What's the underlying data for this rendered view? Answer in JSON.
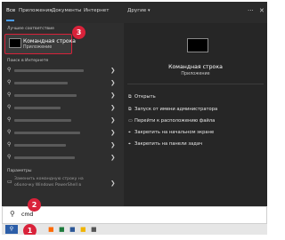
{
  "tabs": {
    "all": "Все",
    "apps": "Приложения",
    "documents": "Документы",
    "web": "Интернет",
    "more": "Другие"
  },
  "best_match": {
    "header": "Лучшее соответствие",
    "title": "Командная строка",
    "subtitle": "Приложение"
  },
  "web_section": {
    "header": "Поиск в Интернете"
  },
  "settings_section": {
    "header": "Параметры",
    "item1": "Заменить командную строку на",
    "item2": "оболочку Windows PowerShell в"
  },
  "details": {
    "title": "Командная строка",
    "subtitle": "Приложение",
    "actions": [
      "Открыть",
      "Запуск от имени администратора",
      "Перейти к расположению файла",
      "Закрепить на начальном экране",
      "Закрепить на панели задач"
    ]
  },
  "search": {
    "value": "cmd"
  },
  "steps": [
    "1",
    "2",
    "3"
  ],
  "colors": {
    "accent": "#4a9eff",
    "highlight": "#d9223a",
    "panel_dark": "#2e2e2e"
  }
}
